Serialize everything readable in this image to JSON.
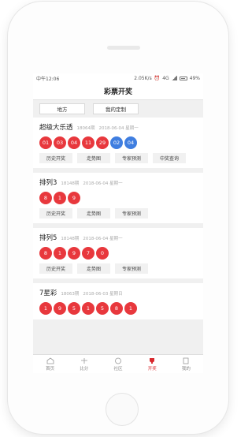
{
  "status_bar": {
    "carrier_time": "中午12:06",
    "speed": "2.05K/s",
    "network": "4G",
    "battery": "49%"
  },
  "title": "彩票开奖",
  "filters": [
    "地方",
    "我的定制"
  ],
  "cards": [
    {
      "name": "超级大乐透",
      "issue": "18064期",
      "date": "2018-06-04 星期一",
      "balls": [
        "01",
        "03",
        "04",
        "11",
        "29",
        "02",
        "04"
      ],
      "actions": [
        "历史开奖",
        "走势图",
        "专家预测",
        "中奖查询"
      ]
    },
    {
      "name": "排列3",
      "issue": "18148期",
      "date": "2018-06-04 星期一",
      "balls": [
        "8",
        "1",
        "9"
      ],
      "actions": [
        "历史开奖",
        "走势图",
        "专家预测"
      ]
    },
    {
      "name": "排列5",
      "issue": "18148期",
      "date": "2018-06-04 星期一",
      "balls": [
        "8",
        "1",
        "9",
        "7",
        "0"
      ],
      "actions": [
        "历史开奖",
        "走势图",
        "专家预测"
      ]
    },
    {
      "name": "7星彩",
      "issue": "18063期",
      "date": "2018-06-03 星期日",
      "balls": [
        "1",
        "9",
        "5",
        "1",
        "5",
        "8",
        "1"
      ],
      "actions": []
    }
  ],
  "tabbar": [
    "首页",
    "比分",
    "社区",
    "开奖",
    "我的"
  ],
  "colors": {
    "red_ball": "#e8383d",
    "blue_ball": "#3f7ee0",
    "active_tab": "#d8282d"
  }
}
